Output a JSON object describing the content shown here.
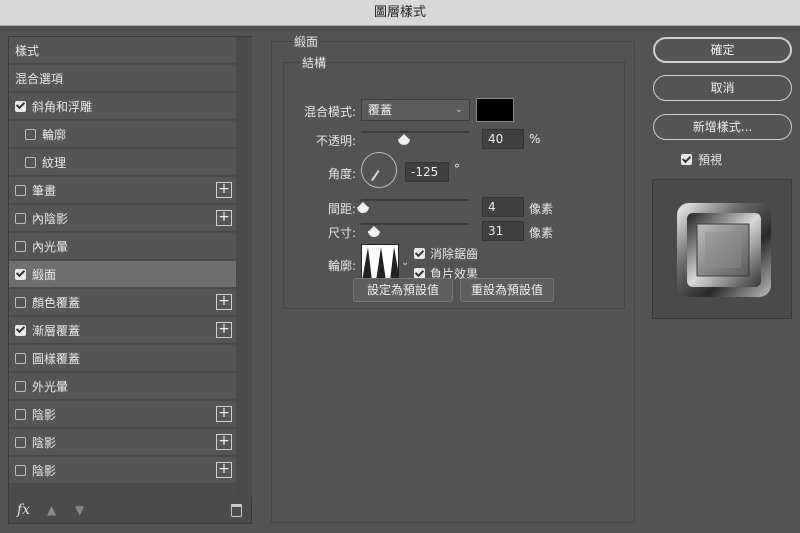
{
  "window": {
    "title": "圖層樣式"
  },
  "styles_list": [
    {
      "label": "樣式",
      "has_checkbox": false,
      "checked": false,
      "indent": false,
      "has_add": false,
      "selected": false
    },
    {
      "label": "混合選項",
      "has_checkbox": false,
      "checked": false,
      "indent": false,
      "has_add": false,
      "selected": false
    },
    {
      "label": "斜角和浮雕",
      "has_checkbox": true,
      "checked": true,
      "indent": false,
      "has_add": false,
      "selected": false
    },
    {
      "label": "輪廓",
      "has_checkbox": true,
      "checked": false,
      "indent": true,
      "has_add": false,
      "selected": false
    },
    {
      "label": "紋理",
      "has_checkbox": true,
      "checked": false,
      "indent": true,
      "has_add": false,
      "selected": false
    },
    {
      "label": "筆畫",
      "has_checkbox": true,
      "checked": false,
      "indent": false,
      "has_add": true,
      "selected": false
    },
    {
      "label": "內陰影",
      "has_checkbox": true,
      "checked": false,
      "indent": false,
      "has_add": true,
      "selected": false
    },
    {
      "label": "內光暈",
      "has_checkbox": true,
      "checked": false,
      "indent": false,
      "has_add": false,
      "selected": false
    },
    {
      "label": "緞面",
      "has_checkbox": true,
      "checked": true,
      "indent": false,
      "has_add": false,
      "selected": true
    },
    {
      "label": "顏色覆蓋",
      "has_checkbox": true,
      "checked": false,
      "indent": false,
      "has_add": true,
      "selected": false
    },
    {
      "label": "漸層覆蓋",
      "has_checkbox": true,
      "checked": true,
      "indent": false,
      "has_add": true,
      "selected": false
    },
    {
      "label": "圖樣覆蓋",
      "has_checkbox": true,
      "checked": false,
      "indent": false,
      "has_add": false,
      "selected": false
    },
    {
      "label": "外光暈",
      "has_checkbox": true,
      "checked": false,
      "indent": false,
      "has_add": false,
      "selected": false
    },
    {
      "label": "陰影",
      "has_checkbox": true,
      "checked": false,
      "indent": false,
      "has_add": true,
      "selected": false
    },
    {
      "label": "陰影",
      "has_checkbox": true,
      "checked": false,
      "indent": false,
      "has_add": true,
      "selected": false
    },
    {
      "label": "陰影",
      "has_checkbox": true,
      "checked": false,
      "indent": false,
      "has_add": true,
      "selected": false
    }
  ],
  "add_symbol": "+",
  "bottom_bar": {
    "fx_label": "fx"
  },
  "satin": {
    "section_title": "緞面",
    "structure_title": "結構",
    "blend_mode": {
      "label": "混合模式:",
      "value": "覆蓋"
    },
    "color_swatch": "#000000",
    "opacity": {
      "label": "不透明:",
      "value": "40",
      "unit": "%",
      "slider_level": 0.4
    },
    "angle": {
      "label": "角度:",
      "value": "-125",
      "unit": "°"
    },
    "distance": {
      "label": "間距:",
      "value": "4",
      "unit": "像素",
      "slider_level": 0.02
    },
    "size": {
      "label": "尺寸:",
      "value": "31",
      "unit": "像素",
      "slider_level": 0.12
    },
    "contour": {
      "label": "輪廓:"
    },
    "anti_alias": {
      "label": "消除鋸齒",
      "checked": true
    },
    "invert": {
      "label": "負片效果",
      "checked": true
    },
    "set_default_label": "設定為預設值",
    "reset_default_label": "重設為預設值"
  },
  "actions": {
    "ok_label": "確定",
    "cancel_label": "取消",
    "new_style_label": "新增樣式...",
    "preview": {
      "label": "預視",
      "checked": true
    }
  }
}
